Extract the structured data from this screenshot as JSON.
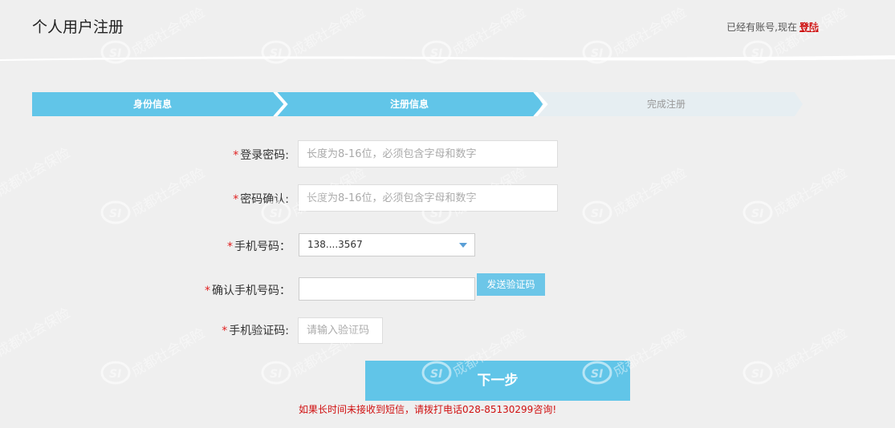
{
  "header": {
    "title": "个人用户注册",
    "account_prompt": "已经有账号,现在",
    "login_link": "登陆"
  },
  "steps": [
    {
      "label": "身份信息",
      "state": "done"
    },
    {
      "label": "注册信息",
      "state": "active"
    },
    {
      "label": "完成注册",
      "state": "pending"
    }
  ],
  "form": {
    "password": {
      "label": "登录密码:",
      "placeholder": "长度为8-16位，必须包含字母和数字",
      "value": ""
    },
    "confirm_password": {
      "label": "密码确认:",
      "placeholder": "长度为8-16位，必须包含字母和数字",
      "value": ""
    },
    "phone": {
      "label": "手机号码：",
      "selected": "138....3567"
    },
    "confirm_phone": {
      "label": "确认手机号码：",
      "value": ""
    },
    "send_code_button": "发送验证码",
    "sms_code": {
      "label": "手机验证码:",
      "placeholder": "请输入验证码",
      "value": ""
    },
    "required_mark": "*"
  },
  "next_button": "下一步",
  "notice": "如果长时间未接收到短信，请拨打电话028-85130299咨询!",
  "watermark_text": "成都社会保险",
  "watermark_logo": "SI",
  "colors": {
    "accent": "#61c5e8",
    "step_pending": "#e6eef2",
    "required": "#e02020",
    "notice": "#d01010",
    "login_link": "#cc0000",
    "background": "#efefef"
  }
}
